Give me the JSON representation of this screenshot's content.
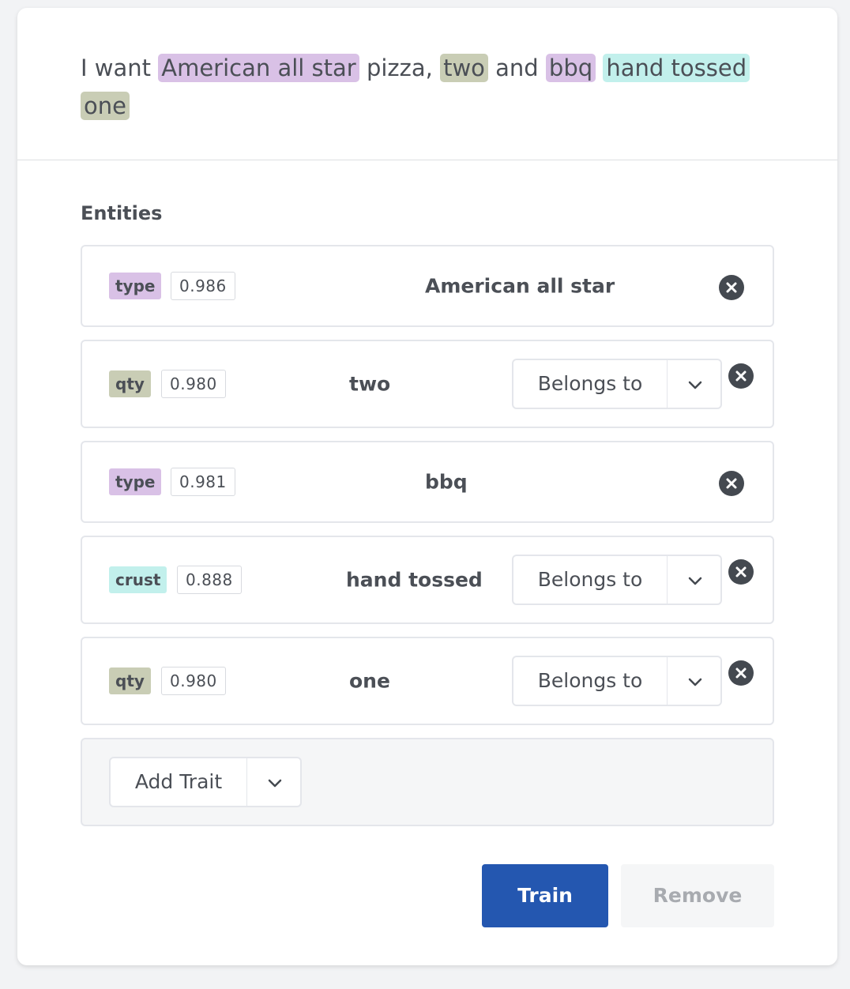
{
  "colors": {
    "type": "#d9c1e6",
    "qty": "#c9cdb5",
    "crust": "#c2f0ec",
    "primary": "#2457b0"
  },
  "utterance": {
    "segments": [
      {
        "text": "I want ",
        "entity": null
      },
      {
        "text": "American all star",
        "entity": "type"
      },
      {
        "text": " pizza, ",
        "entity": null
      },
      {
        "text": "two",
        "entity": "qty"
      },
      {
        "text": " and ",
        "entity": null
      },
      {
        "text": "bbq",
        "entity": "type"
      },
      {
        "text": " ",
        "entity": null
      },
      {
        "text": "hand tossed",
        "entity": "crust"
      },
      {
        "text": " ",
        "entity": null
      },
      {
        "text": "one",
        "entity": "qty"
      }
    ]
  },
  "entities_section": {
    "title": "Entities",
    "items": [
      {
        "tag": "type",
        "score": "0.986",
        "value": "American all star",
        "belongs_to": null
      },
      {
        "tag": "qty",
        "score": "0.980",
        "value": "two",
        "belongs_to": "Belongs to"
      },
      {
        "tag": "type",
        "score": "0.981",
        "value": "bbq",
        "belongs_to": null
      },
      {
        "tag": "crust",
        "score": "0.888",
        "value": "hand tossed",
        "belongs_to": "Belongs to"
      },
      {
        "tag": "qty",
        "score": "0.980",
        "value": "one",
        "belongs_to": "Belongs to"
      }
    ]
  },
  "trait": {
    "add_label": "Add Trait"
  },
  "actions": {
    "train_label": "Train",
    "remove_label": "Remove"
  },
  "icons": {
    "remove_entity": "close-circle-icon",
    "dropdown": "chevron-down-icon"
  }
}
